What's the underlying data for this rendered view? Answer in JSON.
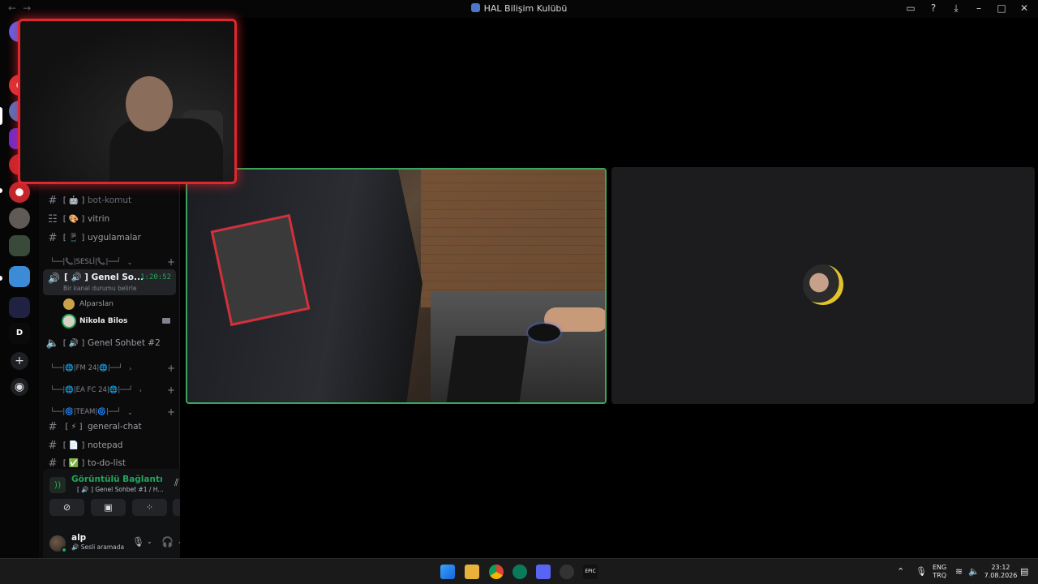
{
  "window": {
    "title": "HAL Bilişim Kulübü",
    "back_glyph": "←",
    "forward_glyph": "→",
    "tools": [
      "inbox-icon",
      "help-icon",
      "download-icon",
      "minimize-icon",
      "maximize-icon",
      "close-icon"
    ]
  },
  "channels": {
    "text": [
      {
        "label": "bot-komut",
        "emoji": "[ 🤖 ]",
        "dim": true
      },
      {
        "label": "vitrin",
        "emoji": "[ 🎨 ]",
        "dim": false
      },
      {
        "label": "uygulamalar",
        "emoji": "[ 📱 ]",
        "dim": false
      }
    ],
    "cat_sesli": "└──|📞|SESLİ|📞|──┘",
    "voice_active": {
      "label": "Genel So...",
      "prefix": "[ 🔊 ]",
      "timer": "1:20:52",
      "status": "Bir kanal durumu belirle"
    },
    "voice_users": [
      {
        "name": "Alparslan",
        "speaking": false,
        "bold": false
      },
      {
        "name": "Nikola Bilos",
        "speaking": true,
        "bold": true
      }
    ],
    "voice_second": {
      "prefix": "[ 🔊 ]",
      "label": "Genel Sohbet #2"
    },
    "cat_fm": "└──|🌐|FM 24|🌐|──┘",
    "cat_ea": "└──|🌐|EA FC 24|🌐|──┘",
    "cat_team": "└──|🌀|TEAM|🌀|──┘",
    "text2": [
      {
        "label": "general-chat",
        "emoji": "[ ⚡ ]"
      },
      {
        "label": "notepad",
        "emoji": "[ 📄 ]"
      },
      {
        "label": "to-do-list",
        "emoji": "[ ✅ ]"
      }
    ]
  },
  "voice_panel": {
    "title": "Görüntülü Bağlantı Kuruldu",
    "subtitle": "[ 🔊 ] Genel Sohbet #1 / HAL ...",
    "buttons": [
      "camera-off-icon",
      "screen-share-icon",
      "activity-icon",
      "soundboard-icon"
    ]
  },
  "user": {
    "name": "alp",
    "status": "🔊 Sesli aramada"
  },
  "taskbar": {
    "lang_top": "ENG",
    "lang_bottom": "TRQ",
    "time": "23:12",
    "date": "7.08.2026"
  },
  "colors": {
    "accent_green": "#23a55a",
    "pip_border": "#e1262f",
    "speaking_border": "#3ba55d"
  }
}
